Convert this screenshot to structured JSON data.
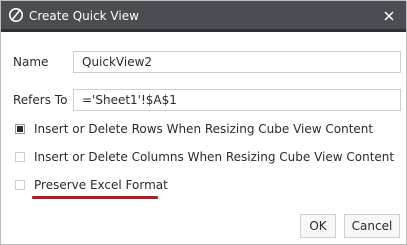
{
  "window": {
    "title": "Create Quick View",
    "logo_icon": "optimus-logo-icon",
    "close_icon": "close-x-icon"
  },
  "form": {
    "name_label": "Name",
    "name_value": "QuickView2",
    "refers_label": "Refers To",
    "refers_value": "='Sheet1'!$A$1"
  },
  "options": [
    {
      "label": "Insert or Delete Rows When Resizing Cube View Content",
      "checked": true
    },
    {
      "label": "Insert or Delete Columns When Resizing Cube View Content",
      "checked": false
    },
    {
      "label": "Preserve Excel Format",
      "checked": false
    }
  ],
  "buttons": {
    "ok_label": "OK",
    "cancel_label": "Cancel"
  },
  "colors": {
    "titlebar": "#4a4d51",
    "highlight_underline": "#c0171f"
  }
}
